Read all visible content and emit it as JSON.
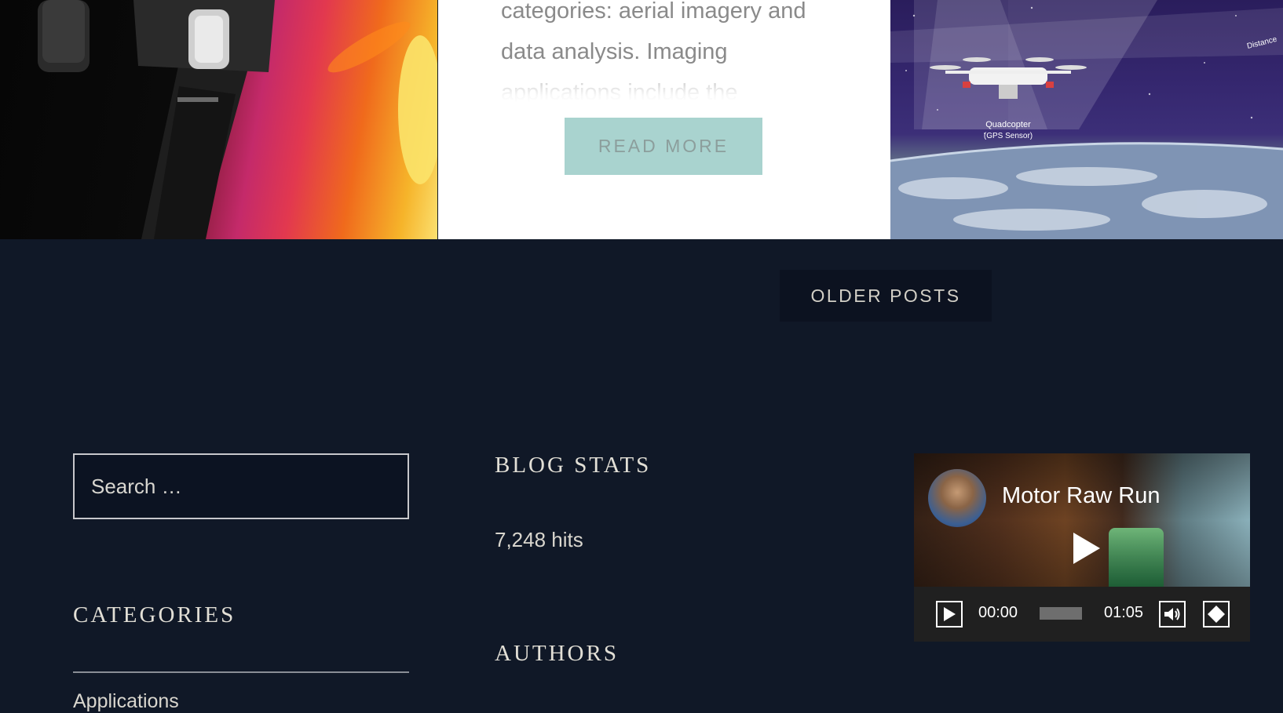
{
  "posts": {
    "middle": {
      "excerpt_lines": [
        "categories: aerial imagery and",
        "data analysis. Imaging",
        "applications include the"
      ],
      "read_more_label": "READ MORE"
    },
    "right_image": {
      "caption_1": "Quadcopter",
      "caption_2": "(GPS Sensor)",
      "caption_sky": "Distance"
    }
  },
  "pagination": {
    "older_posts_label": "OLDER POSTS"
  },
  "search": {
    "placeholder": "Search …"
  },
  "categories": {
    "title": "CATEGORIES",
    "items": [
      "Applications"
    ]
  },
  "blog_stats": {
    "title": "BLOG STATS",
    "hits": "7,248 hits"
  },
  "authors": {
    "title": "AUTHORS"
  },
  "video": {
    "title": "Motor Raw Run",
    "current_time": "00:00",
    "duration": "01:05",
    "progress": 0
  },
  "colors": {
    "page_background": "#101827",
    "read_more_bg": "#a9d3cf",
    "text_light": "#e2dfd6"
  }
}
